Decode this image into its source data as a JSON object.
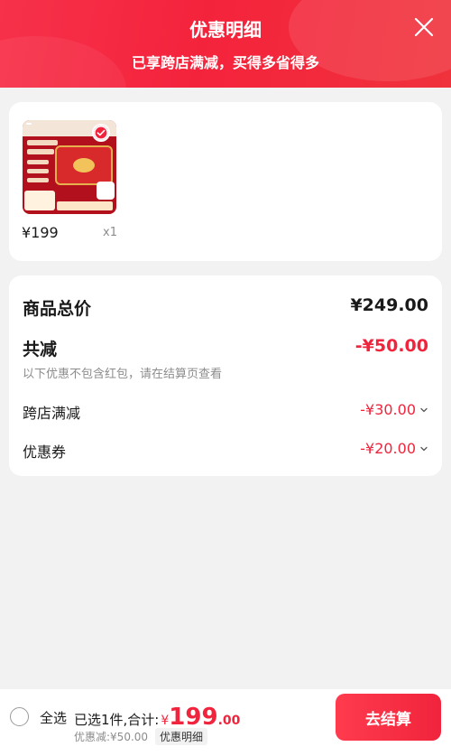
{
  "header": {
    "title": "优惠明细",
    "subtitle": "已享跨店满减，买得多省得多",
    "close_icon": "close-icon"
  },
  "product": {
    "price": "¥199",
    "quantity": "x1",
    "selected": true
  },
  "summary": {
    "total_label": "商品总价",
    "total_value": "¥249.00",
    "reduction_label": "共减",
    "reduction_value": "-¥50.00",
    "note": "以下优惠不包含红包，请在结算页查看",
    "items": [
      {
        "label": "跨店满减",
        "value": "-¥30.00"
      },
      {
        "label": "优惠券",
        "value": "-¥20.00"
      }
    ]
  },
  "bottom": {
    "select_all": "全选",
    "selected_text": "已选1件,合计:",
    "currency": "¥",
    "amount_int": "199",
    "amount_dec": ".00",
    "discount_text": "优惠减:¥50.00",
    "detail_label": "优惠明细",
    "checkout_label": "去结算"
  },
  "colors": {
    "accent": "#f0243c",
    "header": "#f4233c"
  }
}
